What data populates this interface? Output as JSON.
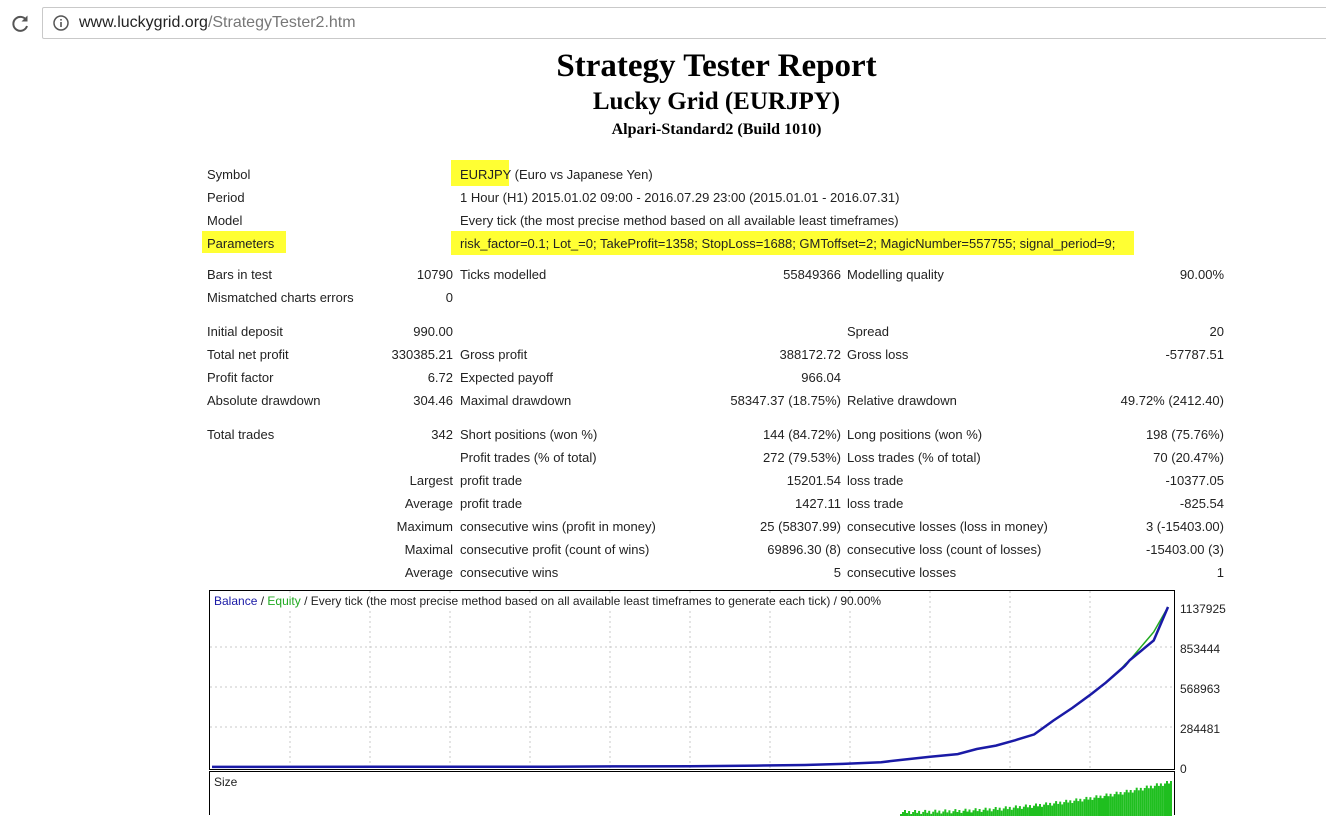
{
  "browser": {
    "url_domain": "www.luckygrid.org",
    "url_path": "/StrategyTester2.htm"
  },
  "report": {
    "title": "Strategy Tester Report",
    "subtitle": "Lucky Grid (EURJPY)",
    "server": "Alpari-Standard2 (Build 1010)"
  },
  "info": {
    "symbol_label": "Symbol",
    "symbol_code": "EURJPY",
    "symbol_rest": " (Euro vs Japanese Yen)",
    "period_label": "Period",
    "period_value": "1 Hour (H1) 2015.01.02 09:00 - 2016.07.29 23:00 (2015.01.01 - 2016.07.31)",
    "model_label": "Model",
    "model_value": "Every tick (the most precise method based on all available least timeframes)",
    "parameters_label": "Parameters",
    "parameters_value": "risk_factor=0.1; Lot_=0; TakeProfit=1358; StopLoss=1688; GMToffset=2; MagicNumber=557755; signal_period=9;"
  },
  "stats": {
    "bars_label": "Bars in test",
    "bars_value": "10790",
    "ticks_label": "Ticks modelled",
    "ticks_value": "55849366",
    "quality_label": "Modelling quality",
    "quality_value": "90.00%",
    "mismatch_label": "Mismatched charts errors",
    "mismatch_value": "0",
    "deposit_label": "Initial deposit",
    "deposit_value": "990.00",
    "spread_label": "Spread",
    "spread_value": "20",
    "netprofit_label": "Total net profit",
    "netprofit_value": "330385.21",
    "grossprofit_label": "Gross profit",
    "grossprofit_value": "388172.72",
    "grossloss_label": "Gross loss",
    "grossloss_value": "-57787.51",
    "pf_label": "Profit factor",
    "pf_value": "6.72",
    "payoff_label": "Expected payoff",
    "payoff_value": "966.04",
    "absdd_label": "Absolute drawdown",
    "absdd_value": "304.46",
    "maxdd_label": "Maximal drawdown",
    "maxdd_value": "58347.37 (18.75%)",
    "reldd_label": "Relative drawdown",
    "reldd_value": "49.72% (2412.40)",
    "trades_label": "Total trades",
    "trades_value": "342",
    "short_label": "Short positions (won %)",
    "short_value": "144 (84.72%)",
    "long_label": "Long positions (won %)",
    "long_value": "198 (75.76%)",
    "ptrades_label": "Profit trades (% of total)",
    "ptrades_value": "272 (79.53%)",
    "ltrades_label": "Loss trades (% of total)",
    "ltrades_value": "70 (20.47%)",
    "largest_label": "Largest",
    "largest_profit_label": "profit trade",
    "largest_profit_value": "15201.54",
    "largest_loss_label": "loss trade",
    "largest_loss_value": "-10377.05",
    "average_label": "Average",
    "average_profit_label": "profit trade",
    "average_profit_value": "1427.11",
    "average_loss_label": "loss trade",
    "average_loss_value": "-825.54",
    "maximum_label": "Maximum",
    "max_wins_label": "consecutive wins (profit in money)",
    "max_wins_value": "25 (58307.99)",
    "max_losses_label": "consecutive losses (loss in money)",
    "max_losses_value": "3 (-15403.00)",
    "maximal_label": "Maximal",
    "maximal_profit_label": "consecutive profit (count of wins)",
    "maximal_profit_value": "69896.30 (8)",
    "maximal_loss_label": "consecutive loss (count of losses)",
    "maximal_loss_value": "-15403.00 (3)",
    "avgcons_label": "Average",
    "avg_wins_label": "consecutive wins",
    "avg_wins_value": "5",
    "avg_losses_label": "consecutive losses",
    "avg_losses_value": "1"
  },
  "chart": {
    "legend_balance": "Balance",
    "legend_sep1": " / ",
    "legend_equity": "Equity",
    "legend_rest": " / Every tick (the most precise method based on all available least timeframes to generate each tick) / 90.00%",
    "size_label": "Size",
    "y_labels": [
      "1137925",
      "853444",
      "568963",
      "284481",
      "0"
    ],
    "colors": {
      "balance": "#1a1aa6",
      "equity": "#22aa22",
      "size": "#1fbf1f",
      "grid": "#c8c8c8"
    }
  },
  "chart_data": {
    "type": "line",
    "series": [
      {
        "name": "Balance",
        "values": [
          990,
          2000,
          4000,
          6000,
          10000,
          14000,
          22000,
          34000,
          50000,
          72000,
          92000,
          128000,
          152000,
          190000,
          232000,
          330000,
          420000,
          520000,
          600000,
          690000,
          720000,
          760000,
          900000,
          1137925
        ]
      },
      {
        "name": "Equity",
        "values": [
          990,
          2000,
          4000,
          6000,
          10000,
          14000,
          22000,
          34000,
          50000,
          72000,
          92000,
          128000,
          152000,
          190000,
          232000,
          330000,
          420000,
          520000,
          600000,
          690000,
          730000,
          760000,
          960000,
          1137925
        ]
      }
    ],
    "ylim": [
      0,
      1137925
    ],
    "y_ticks": [
      0,
      284481,
      568963,
      853444,
      1137925
    ],
    "grid": true
  }
}
